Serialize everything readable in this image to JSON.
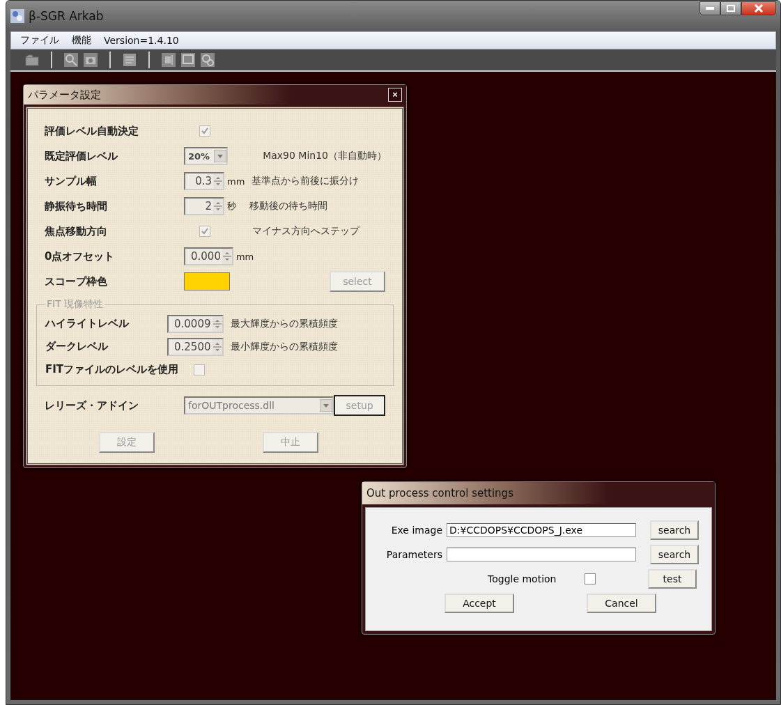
{
  "window": {
    "title": "β-SGR Arkab"
  },
  "menu": [
    {
      "label": "ファイル"
    },
    {
      "label": "機能"
    },
    {
      "label": "Version=1.4.10"
    }
  ],
  "param_dialog": {
    "title": "パラメータ設定",
    "close": "×",
    "rows": [
      {
        "kind": "checkbox",
        "label": "評価レベル自動決定",
        "checked": true
      },
      {
        "kind": "dropdown",
        "label": "既定評価レベル",
        "value": "20%",
        "note": "Max90 Min10（非自動時）"
      },
      {
        "kind": "spinner",
        "label": "サンプル幅",
        "value": "0.3",
        "unit": "mm",
        "note": "基準点から前後に振分け"
      },
      {
        "kind": "spinner",
        "label": "静振待ち時間",
        "value": "2",
        "unit": "秒",
        "note": "移動後の待ち時間"
      },
      {
        "kind": "checkbox",
        "label": "焦点移動方向",
        "checked": true,
        "note": "マイナス方向へステップ"
      },
      {
        "kind": "spinner",
        "label": "0点オフセット",
        "value": "0.000",
        "unit": "mm"
      },
      {
        "kind": "color",
        "label": "スコープ枠色",
        "color": "#ffd200",
        "button": {
          "label": "select",
          "disabled": true
        }
      }
    ],
    "group": {
      "title": "FIT 現像特性",
      "rows": [
        {
          "kind": "spinner",
          "label": "ハイライトレベル",
          "value": "0.0009",
          "note": "最大輝度からの累積頻度"
        },
        {
          "kind": "spinner",
          "label": "ダークレベル",
          "value": "0.2500",
          "note": "最小輝度からの累積頻度"
        },
        {
          "kind": "checkbox",
          "label": "FITファイルのレベルを使用",
          "checked": false
        }
      ]
    },
    "addin": {
      "label": "レリーズ・アドイン",
      "value": "forOUTprocess.dll",
      "button": {
        "label": "setup",
        "disabled": true
      }
    },
    "buttons": [
      {
        "label": "設定",
        "disabled": true
      },
      {
        "label": "中止",
        "disabled": true
      }
    ]
  },
  "out_dialog": {
    "title": "Out process control settings",
    "fields": [
      {
        "label": "Exe image",
        "value": "D:¥CCDOPS¥CCDOPS_J.exe",
        "button": "search"
      },
      {
        "label": "Parameters",
        "button": "search"
      }
    ],
    "toggle": {
      "label": "Toggle motion",
      "checked": false
    },
    "test_button": "test",
    "buttons": [
      {
        "label": "Accept"
      },
      {
        "label": "Cancel"
      }
    ]
  }
}
